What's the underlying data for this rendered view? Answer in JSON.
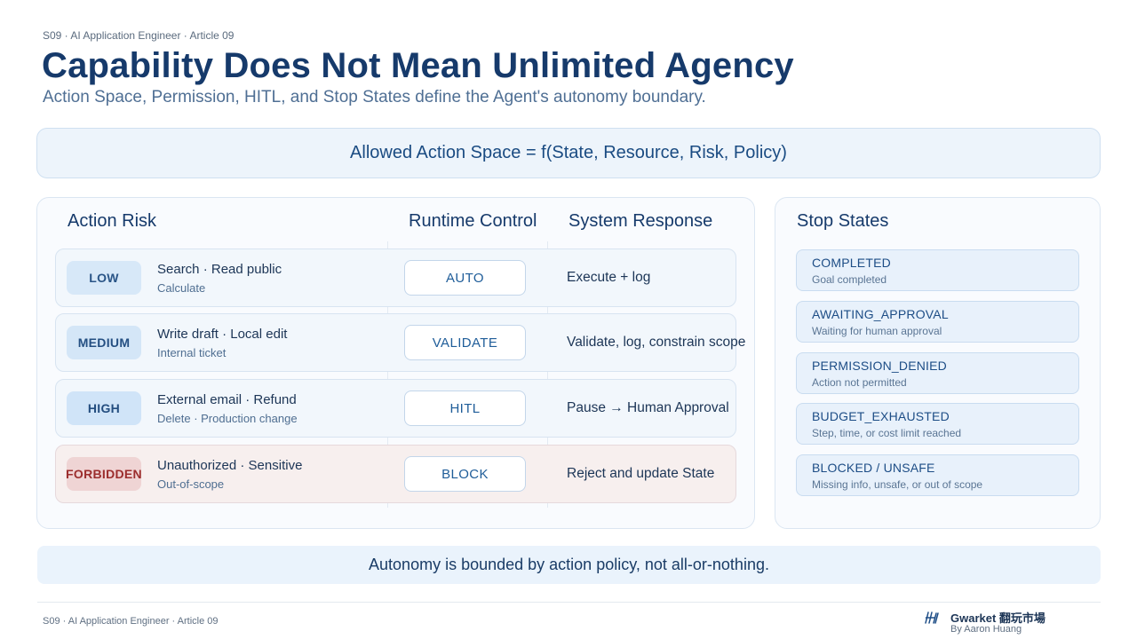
{
  "header": {
    "kicker": "S09 · AI Application Engineer · Article 09",
    "title": "Capability Does Not Mean Unlimited Agency",
    "subtitle": "Action Space, Permission, HITL, and Stop States define the Agent's autonomy boundary."
  },
  "formula": "Allowed Action Space = f(State, Resource, Risk, Policy)",
  "table": {
    "headers": {
      "risk": "Action Risk",
      "control": "Runtime Control",
      "response": "System Response"
    },
    "rows": [
      {
        "risk": "LOW",
        "title": "Search · Read public",
        "sub": "Calculate",
        "control": "AUTO",
        "response": "Execute + log"
      },
      {
        "risk": "MEDIUM",
        "title": "Write draft · Local edit",
        "sub": "Internal ticket",
        "control": "VALIDATE",
        "response": "Validate, log, constrain scope"
      },
      {
        "risk": "HIGH",
        "title": "External email · Refund",
        "sub": "Delete · Production change",
        "control": "HITL",
        "response": "Pause → Human Approval"
      },
      {
        "risk": "FORBIDDEN",
        "title": "Unauthorized · Sensitive",
        "sub": "Out-of-scope",
        "control": "BLOCK",
        "response": "Reject and update State"
      }
    ]
  },
  "stop_states": {
    "heading": "Stop States",
    "items": [
      {
        "name": "COMPLETED",
        "desc": "Goal completed"
      },
      {
        "name": "AWAITING_APPROVAL",
        "desc": "Waiting for human approval"
      },
      {
        "name": "PERMISSION_DENIED",
        "desc": "Action not permitted"
      },
      {
        "name": "BUDGET_EXHAUSTED",
        "desc": "Step, time, or cost limit reached"
      },
      {
        "name": "BLOCKED / UNSAFE",
        "desc": "Missing info, unsafe, or out of scope"
      }
    ]
  },
  "bottom_note": "Autonomy is bounded by action policy, not all-or-nothing.",
  "footer": {
    "left": "S09 · AI Application Engineer · Article 09",
    "brand": "Gwarket 翻玩市場",
    "by": "By Aaron Huang",
    "logo_icon": "gwarket-logo-icon"
  },
  "colors": {
    "title": "#163a6b",
    "accent": "#1f5d99",
    "forbidden": "#9b2d2d",
    "panel_bg": "#f9fbfe"
  }
}
